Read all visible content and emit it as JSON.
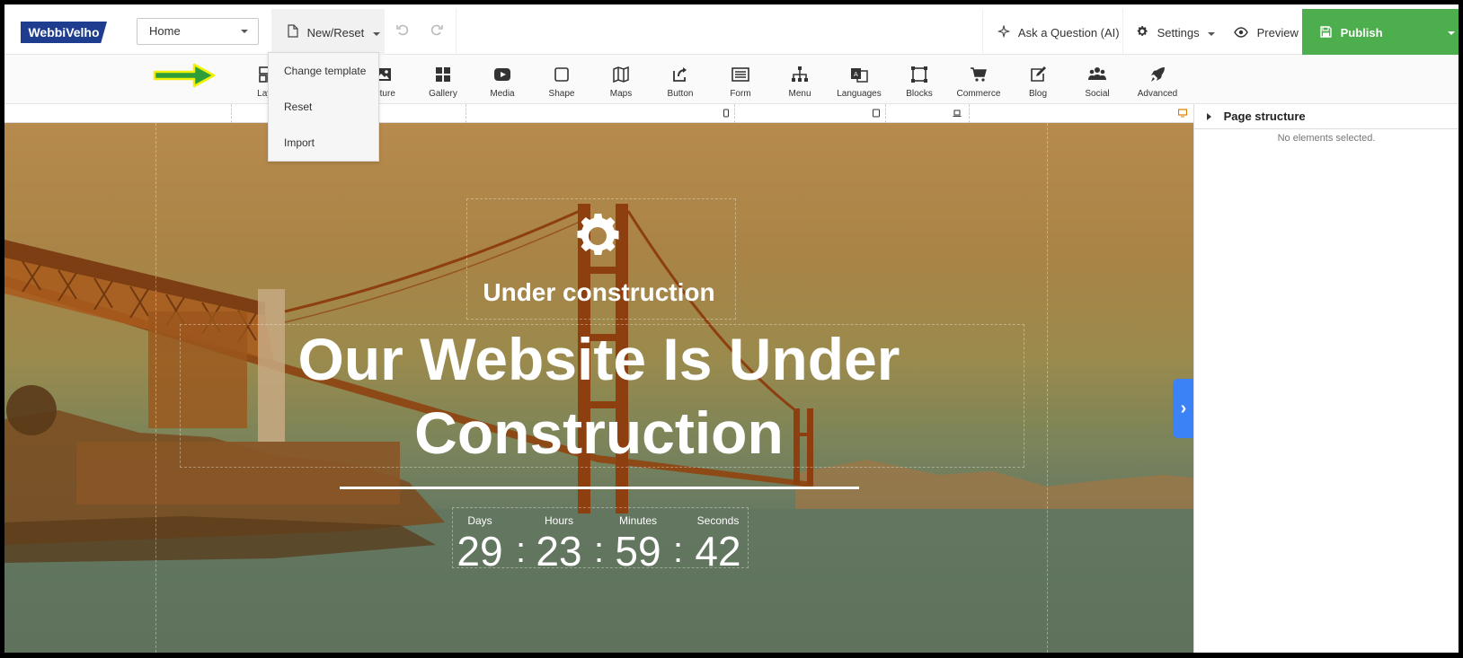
{
  "topbar": {
    "logo": "WebbiVelho",
    "page_select": "Home",
    "new_reset": "New/Reset",
    "ask": "Ask a Question (AI)",
    "settings": "Settings",
    "preview": "Preview",
    "publish": "Publish"
  },
  "toolbar": {
    "items": [
      "Layout",
      "Structure",
      "Gallery",
      "Media",
      "Shape",
      "Maps",
      "Button",
      "Form",
      "Menu",
      "Languages",
      "Blocks",
      "Commerce",
      "Blog",
      "Social",
      "Advanced"
    ],
    "visible_labels": {
      "layout": "Layo",
      "structure": "ucture"
    }
  },
  "dropdown": {
    "items": [
      "Change template",
      "Reset",
      "Import"
    ]
  },
  "canvas": {
    "kicker": "Under construction",
    "headline": "Our Website Is Under Construction",
    "countdown": [
      {
        "label": "Days",
        "value": "29"
      },
      {
        "label": "Hours",
        "value": "23"
      },
      {
        "label": "Minutes",
        "value": "59"
      },
      {
        "label": "Seconds",
        "value": "42"
      }
    ],
    "separator": ":"
  },
  "panel": {
    "title": "Page structure",
    "empty_text": "No elements selected."
  },
  "colors": {
    "logo_bg": "#1e3d8f",
    "publish_bg": "#4cae4c",
    "side_tab": "#3b82f6",
    "arrow": "#2e9e3a",
    "arrow_outline": "#f0f000"
  }
}
